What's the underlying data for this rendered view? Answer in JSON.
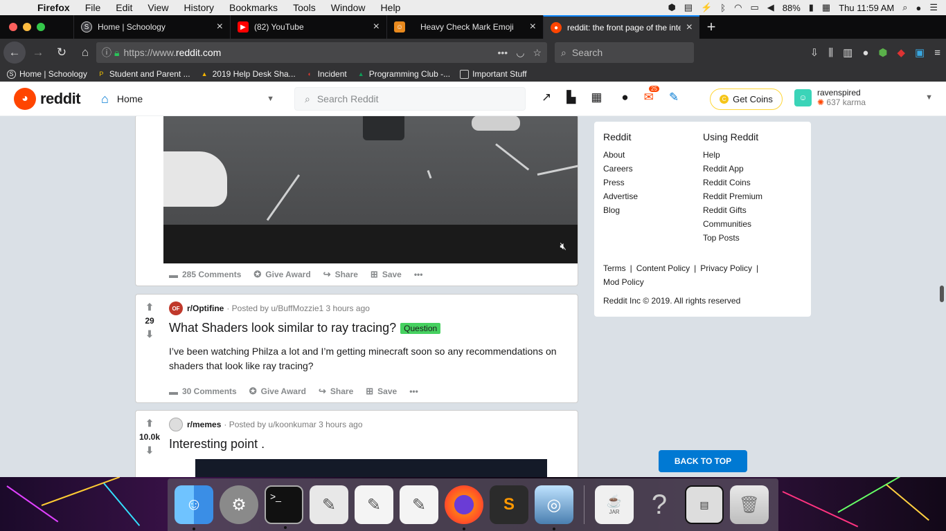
{
  "menubar": {
    "app": "Firefox",
    "items": [
      "File",
      "Edit",
      "View",
      "History",
      "Bookmarks",
      "Tools",
      "Window",
      "Help"
    ],
    "battery": "88%",
    "clock": "Thu 11:59 AM"
  },
  "tabs": [
    {
      "label": "Home | Schoology",
      "icon": "schoology-icon",
      "color": "#3a3a3e"
    },
    {
      "label": "(82) YouTube",
      "icon": "youtube-icon",
      "color": "#ff0000"
    },
    {
      "label": "Heavy Check Mark Emoji",
      "icon": "emoji-site-icon",
      "color": "#e8891d"
    },
    {
      "label": "reddit: the front page of the inte",
      "icon": "reddit-icon",
      "color": "#ff4500"
    }
  ],
  "nav": {
    "url_prefix": "https://www.",
    "url_host": "reddit.com",
    "search_placeholder": "Search"
  },
  "bookmarks": [
    {
      "label": "Home | Schoology",
      "icon": "schoology-icon"
    },
    {
      "label": "Student and Parent ...",
      "icon": "powerschool-icon"
    },
    {
      "label": "2019 Help Desk Sha...",
      "icon": "google-drive-icon"
    },
    {
      "label": "Incident",
      "icon": "incident-icon"
    },
    {
      "label": "Programming Club -...",
      "icon": "google-drive-icon"
    },
    {
      "label": "Important Stuff",
      "icon": "folder-icon"
    }
  ],
  "reddit_header": {
    "logo_text": "reddit",
    "feed_label": "Home",
    "search_placeholder": "Search Reddit",
    "notifications_count": "25",
    "coins_label": "Get Coins",
    "username": "ravenspired",
    "karma": "637 karma"
  },
  "posts": [
    {
      "actions": {
        "comments": "285 Comments",
        "award": "Give Award",
        "share": "Share",
        "save": "Save"
      }
    },
    {
      "votes": "29",
      "subreddit": "r/Optifine",
      "sub_icon_text": "OF",
      "posted_by": "· Posted by u/BuffMozzie1 3 hours ago",
      "title": "What Shaders look similar to ray tracing?",
      "flair": "Question",
      "body": "I’ve been watching Philza a lot and I’m getting minecraft soon so any recommendations on shaders that look like ray tracing?",
      "actions": {
        "comments": "30 Comments",
        "award": "Give Award",
        "share": "Share",
        "save": "Save"
      }
    },
    {
      "votes": "10.0k",
      "subreddit": "r/memes",
      "posted_by": "· Posted by u/koonkumar 3 hours ago",
      "title": "Interesting point ."
    }
  ],
  "sidebar": {
    "col1_title": "Reddit",
    "col1_links": [
      "About",
      "Careers",
      "Press",
      "Advertise",
      "Blog"
    ],
    "col2_title": "Using Reddit",
    "col2_links": [
      "Help",
      "Reddit App",
      "Reddit Coins",
      "Reddit Premium",
      "Reddit Gifts",
      "Communities",
      "Top Posts"
    ],
    "legal": [
      "Terms",
      "Content Policy",
      "Privacy Policy",
      "Mod Policy"
    ],
    "copyright": "Reddit Inc © 2019. All rights reserved",
    "back_to_top": "BACK TO TOP"
  },
  "dock": {
    "apps": [
      "finder-icon",
      "system-preferences-icon",
      "terminal-icon",
      "script-editor-icon",
      "textedit-icon",
      "textedit-icon",
      "firefox-icon",
      "sublime-text-icon",
      "preview-icon",
      "jar-launcher-icon",
      "help-question-icon",
      "screenshot-app-icon",
      "trash-icon"
    ],
    "jar_label": "JAR"
  }
}
